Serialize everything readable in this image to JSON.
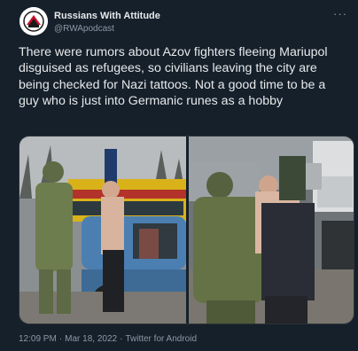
{
  "author": {
    "name": "Russians With Attitude",
    "handle": "@RWApodcast"
  },
  "more_icon": "ellipsis-icon",
  "tweet": {
    "text": "There were rumors about Azov fighters fleeing Mariupol disguised as refugees, so civilians leaving the city are being checked for Nazi tattoos. Not a good time to be a guy who is just into Germanic runes as a hobby"
  },
  "media": {
    "photo_count": 2
  },
  "meta": {
    "time": "12:09 PM",
    "date": "Mar 18, 2022",
    "separator": "·",
    "client": "Twitter for Android"
  },
  "colors": {
    "background": "#15202b",
    "text_primary": "#e7e9ea",
    "text_secondary": "#8b98a5"
  }
}
